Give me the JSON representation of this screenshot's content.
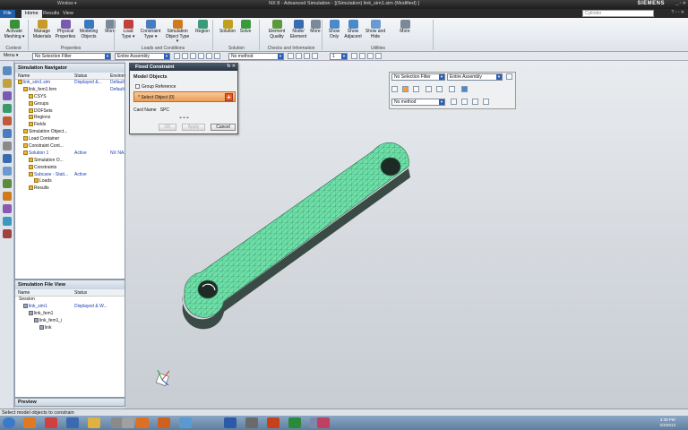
{
  "window": {
    "title": "NX 8 - Advanced Simulation - [(Simulation) link_sim1.sim (Modified) ]",
    "quick_access": "Window ▾",
    "brand": "SIEMENS",
    "controls": "_ ▫ ✕"
  },
  "menu": {
    "tabs": [
      "File",
      "Home",
      "Results",
      "View"
    ],
    "search_placeholder": "Cylinder",
    "right_controls": "? ▫ ▫ ✕"
  },
  "ribbon": {
    "buttons": [
      {
        "label": "Activate Meshing ▾",
        "icon": "activate-meshing-icon",
        "color": "#3a8f3a"
      },
      {
        "label": "Manage Materials",
        "icon": "manage-materials-icon",
        "color": "#c89a2a"
      },
      {
        "label": "Physical Properties",
        "icon": "physical-properties-icon",
        "color": "#7a5ab0"
      },
      {
        "label": "Modeling Objects",
        "icon": "modeling-objects-icon",
        "color": "#3a78c0"
      },
      {
        "label": "More",
        "icon": "more-icon",
        "color": "#7a8898"
      },
      {
        "label": "Load Type ▾",
        "icon": "load-type-icon",
        "color": "#c04040"
      },
      {
        "label": "Constraint Type ▾",
        "icon": "constraint-type-icon",
        "color": "#4a7ac0"
      },
      {
        "label": "Simulation Object Type ▾",
        "icon": "simulation-object-type-icon",
        "color": "#d07a20"
      },
      {
        "label": "Region",
        "icon": "region-icon",
        "color": "#3a9a7a"
      },
      {
        "label": "Solution",
        "icon": "solution-icon",
        "color": "#c0a020"
      },
      {
        "label": "Solve",
        "icon": "solve-icon",
        "color": "#3a9a3a"
      },
      {
        "label": "Element Quality",
        "icon": "element-quality-icon",
        "color": "#5a9a3a"
      },
      {
        "label": "Node/ Element",
        "icon": "node-element-icon",
        "color": "#3a6ab0"
      },
      {
        "label": "More",
        "icon": "more-icon",
        "color": "#7a8898"
      },
      {
        "label": "Show Only",
        "icon": "show-only-icon",
        "color": "#4a8ac8"
      },
      {
        "label": "Show Adjacent",
        "icon": "show-adjacent-icon",
        "color": "#4a8ac8"
      },
      {
        "label": "Show and Hide",
        "icon": "show-and-hide-icon",
        "color": "#6a9ad0"
      },
      {
        "label": "More",
        "icon": "more-icon",
        "color": "#7a8898"
      }
    ],
    "groups": [
      "Context",
      "Properties",
      "Loads and Conditions",
      "Solution",
      "Checks and Information",
      "Utilities"
    ]
  },
  "toolbar": {
    "menu_label": "Menu ▾",
    "selection_filter": "No Selection Filter",
    "assembly": "Entire Assembly",
    "snap_method": "No method",
    "layer": "1"
  },
  "navigator": {
    "title": "Simulation Navigator",
    "columns": [
      "Name",
      "Status",
      "Environ"
    ],
    "rows": [
      {
        "name": "link_sim1.sim",
        "status": "Displayed &...",
        "env": "Default",
        "indent": 0
      },
      {
        "name": "link_fem1.fem",
        "status": "",
        "env": "Default",
        "indent": 1
      },
      {
        "name": "CSYS",
        "status": "",
        "env": "",
        "indent": 2
      },
      {
        "name": "Groups",
        "status": "",
        "env": "",
        "indent": 2
      },
      {
        "name": "DOFSets",
        "status": "",
        "env": "",
        "indent": 2
      },
      {
        "name": "Regions",
        "status": "",
        "env": "",
        "indent": 2
      },
      {
        "name": "Fields",
        "status": "",
        "env": "",
        "indent": 2
      },
      {
        "name": "Simulation Object...",
        "status": "",
        "env": "",
        "indent": 1
      },
      {
        "name": "Load Container",
        "status": "",
        "env": "",
        "indent": 1
      },
      {
        "name": "Constraint Cont...",
        "status": "",
        "env": "",
        "indent": 1
      },
      {
        "name": "Solution 1",
        "status": "Active",
        "env": "NX NA...",
        "indent": 1
      },
      {
        "name": "Simulation O...",
        "status": "",
        "env": "",
        "indent": 2
      },
      {
        "name": "Constraints",
        "status": "",
        "env": "",
        "indent": 2
      },
      {
        "name": "Subcase - Stati...",
        "status": "Active",
        "env": "",
        "indent": 2
      },
      {
        "name": "Loads",
        "status": "",
        "env": "",
        "indent": 3
      },
      {
        "name": "Results",
        "status": "",
        "env": "",
        "indent": 2
      }
    ]
  },
  "file_view": {
    "title": "Simulation File View",
    "columns": [
      "Name",
      "Status"
    ],
    "session_label": "Session",
    "rows": [
      {
        "name": "link_sim1",
        "status": "Displayed & W...",
        "indent": 1
      },
      {
        "name": "link_fem1",
        "status": "",
        "indent": 2
      },
      {
        "name": "link_fem1_i",
        "status": "",
        "indent": 3
      },
      {
        "name": "link",
        "status": "",
        "indent": 4
      }
    ],
    "preview_label": "Preview"
  },
  "dialog": {
    "title": "Fixed Constraint",
    "section": "Model Objects",
    "group_reference": "Group Reference",
    "select_object": "* Select Object (0)",
    "card_name_label": "Card Name",
    "card_name_value": "SPC",
    "more": "⌄⌄⌄",
    "ok": "OK",
    "apply": "Apply",
    "cancel": "Cancel"
  },
  "selection_bar": {
    "filter": "No Selection Filter",
    "assembly": "Entire Assembly",
    "method": "No method"
  },
  "status": {
    "message": "Select model objects to constrain"
  },
  "taskbar": {
    "apps": [
      {
        "icon": "start-icon",
        "color": "#3a7ac8"
      },
      {
        "icon": "firefox-icon",
        "color": "#e07a20"
      },
      {
        "icon": "chrome-icon",
        "color": "#d04040"
      },
      {
        "icon": "media-player-icon",
        "color": "#3a6ab0"
      },
      {
        "icon": "explorer-icon",
        "color": "#e0b040"
      },
      {
        "icon": "tool-icon",
        "color": "#8a8a8a"
      },
      {
        "icon": "app-icon",
        "color": "#a0a0a0"
      },
      {
        "icon": "nx-icon",
        "color": "#e07020"
      },
      {
        "icon": "nx2-icon",
        "color": "#d06020"
      },
      {
        "icon": "paint-icon",
        "color": "#5a9ad0"
      },
      {
        "icon": "word-icon",
        "color": "#2a5aa8"
      },
      {
        "icon": "app2-icon",
        "color": "#6a6a6a"
      },
      {
        "icon": "powerpoint-icon",
        "color": "#c8401a"
      },
      {
        "icon": "excel-icon",
        "color": "#2a8a3a"
      },
      {
        "icon": "app3-icon",
        "color": "#7a8aaa"
      },
      {
        "icon": "app4-icon",
        "color": "#c04060"
      }
    ],
    "time": "3:39 PM",
    "date": "2/4/2013"
  },
  "colors": {
    "mesh_fill": "#6fe0a8",
    "mesh_line": "#2a7a5a",
    "accent": "#1f5fa8"
  }
}
